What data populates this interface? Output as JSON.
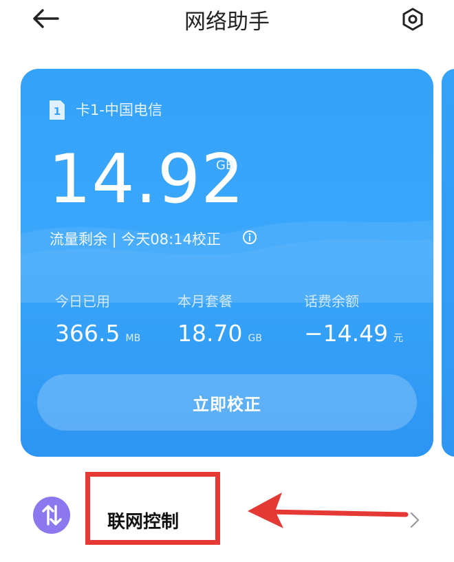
{
  "header": {
    "title": "网络助手",
    "back_icon": "arrow-left-icon",
    "settings_icon": "gear-icon"
  },
  "card": {
    "sim_label": "卡1-中国电信",
    "sim_icon_text": "1",
    "remaining_value": "14.92",
    "remaining_unit": "GB",
    "remaining_text": "流量剩余 | 今天08:14校正",
    "stats": [
      {
        "label": "今日已用",
        "value": "366.5",
        "unit": "MB"
      },
      {
        "label": "本月套餐",
        "value": "18.70",
        "unit": "GB"
      },
      {
        "label": "话费余额",
        "value": "−14.49",
        "unit": "元"
      }
    ],
    "calibrate_label": "立即校正",
    "accent_color": "#35a2fa"
  },
  "network_control": {
    "label": "联网控制",
    "icon": "up-down-arrows-icon",
    "annotation_color": "#e53935"
  }
}
